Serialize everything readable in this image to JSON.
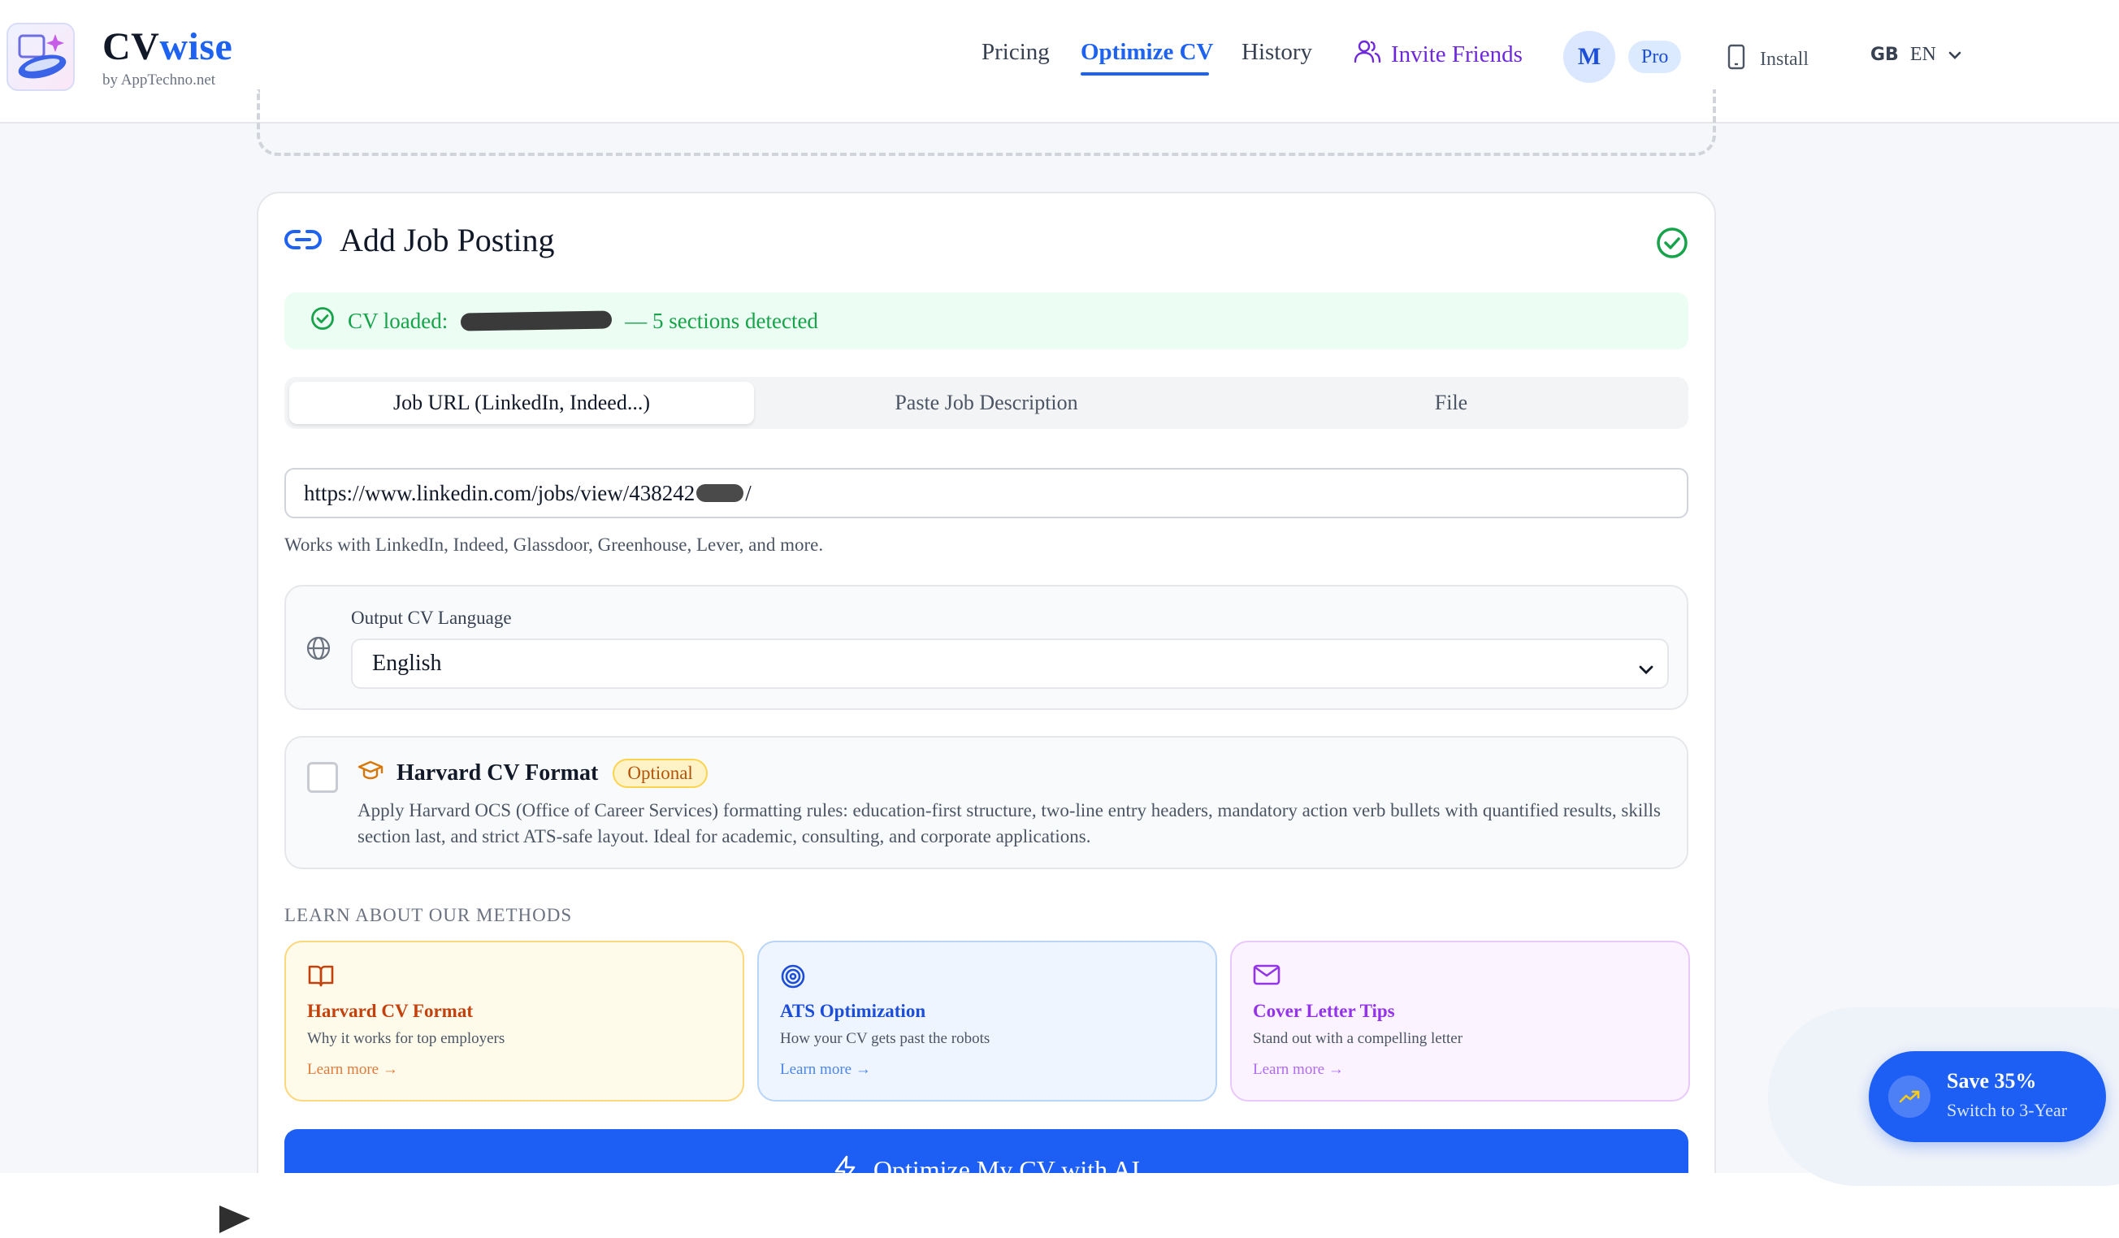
{
  "header": {
    "brand_prefix": "CV",
    "brand_accent": "wise",
    "brand_sub": "by AppTechno.net",
    "nav": {
      "pricing": "Pricing",
      "optimize": "Optimize CV",
      "history": "History",
      "invite": "Invite Friends"
    },
    "avatar_initial": "M",
    "plan_badge": "Pro",
    "install": "Install",
    "region_code": "GB",
    "language": "EN"
  },
  "card": {
    "title": "Add Job Posting",
    "banner": {
      "prefix": "CV loaded:",
      "suffix": "— 5 sections detected"
    },
    "tabs": [
      "Job URL (LinkedIn, Indeed...)",
      "Paste Job Description",
      "File"
    ],
    "active_tab": 0,
    "url": {
      "before": "https://www.linkedin.com/jobs/view/438242",
      "after": "/"
    },
    "url_hint": "Works with LinkedIn, Indeed, Glassdoor, Greenhouse, Lever, and more.",
    "language_field": {
      "label": "Output CV Language",
      "selected": "English"
    },
    "harvard": {
      "title": "Harvard CV Format",
      "badge": "Optional",
      "checked": false,
      "description": "Apply Harvard OCS (Office of Career Services) formatting rules: education-first structure, two-line entry headers, mandatory action verb bullets with quantified results, skills section last, and strict ATS-safe layout. Ideal for academic, consulting, and corporate applications."
    },
    "methods": {
      "label": "LEARN ABOUT OUR METHODS",
      "items": [
        {
          "title": "Harvard CV Format",
          "subtitle": "Why it works for top employers",
          "link": "Learn more →",
          "icon": "book-icon"
        },
        {
          "title": "ATS Optimization",
          "subtitle": "How your CV gets past the robots",
          "link": "Learn more →",
          "icon": "target-icon"
        },
        {
          "title": "Cover Letter Tips",
          "subtitle": "Stand out with a compelling letter",
          "link": "Learn more →",
          "icon": "mail-icon"
        }
      ]
    },
    "submit_label": "Optimize My CV with AI"
  },
  "promo": {
    "title": "Save 35%",
    "subtitle": "Switch to 3-Year"
  },
  "colors": {
    "primary": "#1d5ff5",
    "success": "#16a34a",
    "purple": "#6d28d9",
    "amber": "#c2410c"
  }
}
